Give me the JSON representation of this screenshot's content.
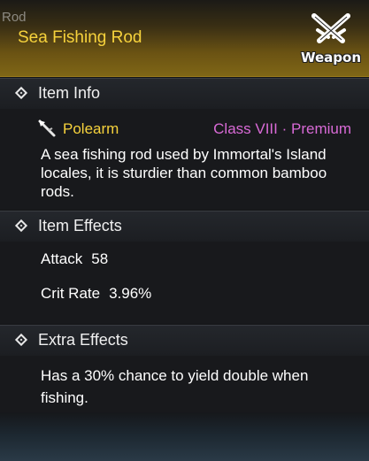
{
  "header": {
    "category": "Rod",
    "item_name": "Sea Fishing Rod",
    "type_label": "Weapon",
    "type_icon": "crossed-swords-icon"
  },
  "item_info": {
    "title": "Item Info",
    "weapon_type": "Polearm",
    "weapon_type_icon": "polearm-icon",
    "item_class": "Class VIII · Premium",
    "description": "A sea fishing rod used by Immortal's Island locales, it is sturdier than common bamboo rods."
  },
  "item_effects": {
    "title": "Item Effects",
    "stats": [
      {
        "name": "Attack",
        "value": "58"
      },
      {
        "name": "Crit Rate",
        "value": "3.96%"
      }
    ]
  },
  "extra_effects": {
    "title": "Extra Effects",
    "text": "Has a 30% chance to yield double when fishing."
  },
  "colors": {
    "name_gold": "#f6d23c",
    "class_pink": "#d86ad6"
  }
}
